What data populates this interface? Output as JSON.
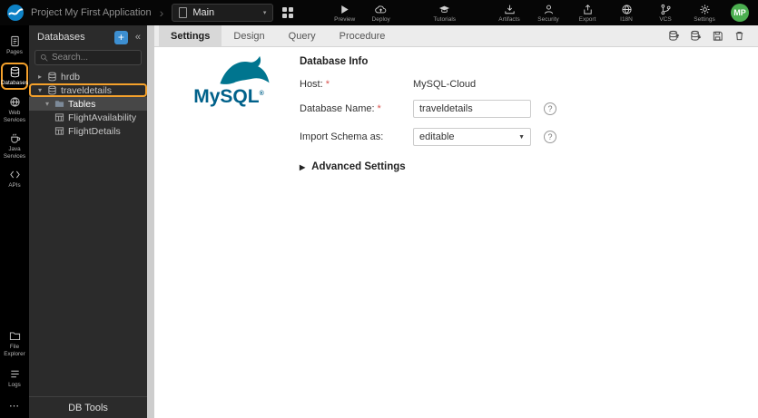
{
  "colors": {
    "accent_orange": "#F5A12B",
    "add_button_blue": "#3D8FD1",
    "avatar_green": "#4CAF50",
    "mysql_blue": "#00618A",
    "required_red": "#D9534F"
  },
  "icons": {
    "breadcrumb_chevron": "›",
    "chevron_down": "▾",
    "chevron_right": "▸",
    "select_caret": "▼",
    "advanced_caret": "▶",
    "help_glyph": "?"
  },
  "topbar": {
    "project_label": "Project My First Application",
    "page_selector_label": "Main",
    "center_actions": [
      {
        "label": "Preview"
      },
      {
        "label": "Deploy"
      },
      {
        "label": "Tutorials"
      }
    ],
    "right_actions": [
      {
        "label": "Artifacts"
      },
      {
        "label": "Security"
      },
      {
        "label": "Export"
      },
      {
        "label": "I18N"
      },
      {
        "label": "VCS"
      },
      {
        "label": "Settings"
      }
    ],
    "avatar_initials": "MP"
  },
  "sidebar": {
    "items": [
      {
        "label": "Pages"
      },
      {
        "label": "Databases"
      },
      {
        "label": "Web Services"
      },
      {
        "label": "Java Services"
      },
      {
        "label": "APIs"
      }
    ],
    "bottom_items": [
      {
        "label": "File Explorer"
      },
      {
        "label": "Logs"
      },
      {
        "label": "⋯"
      }
    ]
  },
  "panel": {
    "title": "Databases",
    "add_button": "+",
    "collapse_glyph": "«",
    "search_placeholder": "Search...",
    "tree": [
      {
        "label": "hrdb"
      },
      {
        "label": "traveldetails"
      },
      {
        "label": "Tables"
      },
      {
        "label": "FlightAvailability"
      },
      {
        "label": "FlightDetails"
      }
    ],
    "footer": "DB Tools"
  },
  "main": {
    "tabs": [
      {
        "label": "Settings"
      },
      {
        "label": "Design"
      },
      {
        "label": "Query"
      },
      {
        "label": "Procedure"
      }
    ],
    "logo_text": "MySQL",
    "logo_reg": "®",
    "section_title": "Database Info",
    "form": {
      "host_label": "Host:",
      "host_required": "*",
      "host_value": "MySQL-Cloud",
      "dbname_label": "Database Name:",
      "dbname_required": "*",
      "dbname_value": "traveldetails",
      "schema_label": "Import Schema as:",
      "schema_value": "editable",
      "advanced_label": "Advanced Settings"
    }
  }
}
